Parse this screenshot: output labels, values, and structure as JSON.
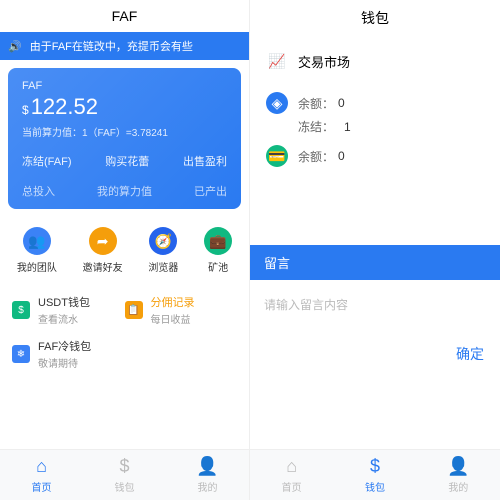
{
  "left": {
    "title": "FAF",
    "notice": "由于FAF在链改中，充提币会有些",
    "card": {
      "name": "FAF",
      "currency": "$",
      "amount": "122.52",
      "sub": "当前算力值：1（FAF）=3.78241",
      "row1": [
        "冻结(FAF)",
        "购买花蕾",
        "出售盈利"
      ],
      "row2": [
        "总投入",
        "我的算力值",
        "已产出"
      ]
    },
    "grid": [
      {
        "label": "我的团队"
      },
      {
        "label": "邀请好友"
      },
      {
        "label": "浏览器"
      },
      {
        "label": "矿池"
      }
    ],
    "wallet": [
      {
        "title": "USDT钱包",
        "sub": "查看流水"
      },
      {
        "title": "分佣记录",
        "sub": "每日收益"
      },
      {
        "title": "FAF冷钱包",
        "sub": "敬请期待"
      }
    ],
    "tabs": [
      "首页",
      "钱包",
      "我的"
    ]
  },
  "right": {
    "title": "钱包",
    "market": "交易市场",
    "bal1": {
      "label": "余额：",
      "val": "0"
    },
    "bal1b": {
      "label": "冻结：",
      "val": "1"
    },
    "bal2": {
      "label": "余额：",
      "val": "0"
    },
    "msg": {
      "header": "留言",
      "placeholder": "请输入留言内容",
      "btn": "确定"
    },
    "tabs": [
      "首页",
      "钱包",
      "我的"
    ]
  }
}
